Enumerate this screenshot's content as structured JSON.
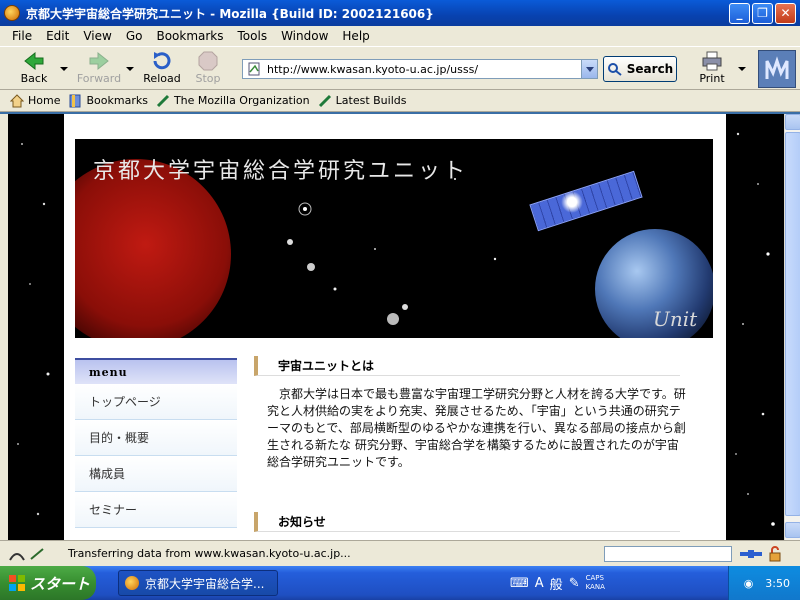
{
  "window": {
    "title": "京都大学宇宙総合学研究ユニット - Mozilla {Build ID: 2002121606}",
    "minimize": "_",
    "maximize": "❐",
    "close": "✕"
  },
  "menubar": [
    "File",
    "Edit",
    "View",
    "Go",
    "Bookmarks",
    "Tools",
    "Window",
    "Help"
  ],
  "toolbar": {
    "back": "Back",
    "forward": "Forward",
    "reload": "Reload",
    "stop": "Stop",
    "url": "http://www.kwasan.kyoto-u.ac.jp/usss/",
    "search": "Search",
    "print": "Print"
  },
  "personal_toolbar": [
    "Home",
    "Bookmarks",
    "The Mozilla Organization",
    "Latest Builds"
  ],
  "page": {
    "banner_title": "京都大学宇宙総合学研究ユニット",
    "banner_tag": "Unit o",
    "menu_header": "menu",
    "menu_items": [
      "トップページ",
      "目的・概要",
      "構成員",
      "セミナー"
    ],
    "section1_title": "宇宙ユニットとは",
    "section1_body": "京都大学は日本で最も豊富な宇宙理工学研究分野と人材を誇る大学です。研究と人材供給の実をより充実、発展させるため、「宇宙」という共通の研究テーマのもとで、部局横断型のゆるやかな連携を行い、異なる部局の接点から創生される新たな 研究分野、宇宙総合学を構築するために設置されたのが宇宙総合学研究ユニットです。",
    "section2_title": "お知らせ"
  },
  "status": {
    "text": "Transferring data from www.kwasan.kyoto-u.ac.jp..."
  },
  "taskbar": {
    "start": "スタート",
    "task_item": "京都大学宇宙総合学...",
    "ime_a": "A",
    "ime_mode": "般",
    "caps": "CAPS",
    "kana": "KANA",
    "clock": "3:50"
  }
}
